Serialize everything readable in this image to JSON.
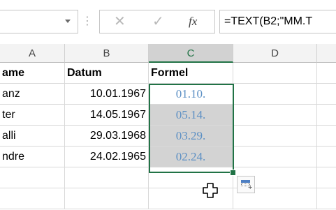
{
  "formula_bar": {
    "name_box_value": "",
    "dots": "⋮",
    "cancel_glyph": "✕",
    "enter_glyph": "✓",
    "fx_label": "fx",
    "formula": "=TEXT(B2;\"MM.T"
  },
  "columns": [
    "A",
    "B",
    "C",
    "D"
  ],
  "active_column": "C",
  "rows": [
    {
      "a": "ame",
      "b": "Datum",
      "c": "Formel"
    },
    {
      "a": "anz",
      "b": "10.01.1967",
      "c": "01.10."
    },
    {
      "a": "ter",
      "b": "14.05.1967",
      "c": "05.14."
    },
    {
      "a": "alli",
      "b": "29.03.1968",
      "c": "03.29."
    },
    {
      "a": "ndre",
      "b": "24.02.1965",
      "c": "02.24."
    },
    {
      "a": "",
      "b": "",
      "c": ""
    },
    {
      "a": "",
      "b": "",
      "c": ""
    }
  ],
  "icons": {
    "dropdown": "chevron-down-icon",
    "cancel": "close-icon",
    "enter": "check-icon",
    "function": "fx-icon",
    "quick_analysis": "quick-analysis-icon",
    "cursor": "fill-cross-cursor-icon"
  },
  "colors": {
    "accent_green": "#217346",
    "formula_result_blue": "#5b8fc4",
    "selection_gray": "#d3d3d3"
  }
}
